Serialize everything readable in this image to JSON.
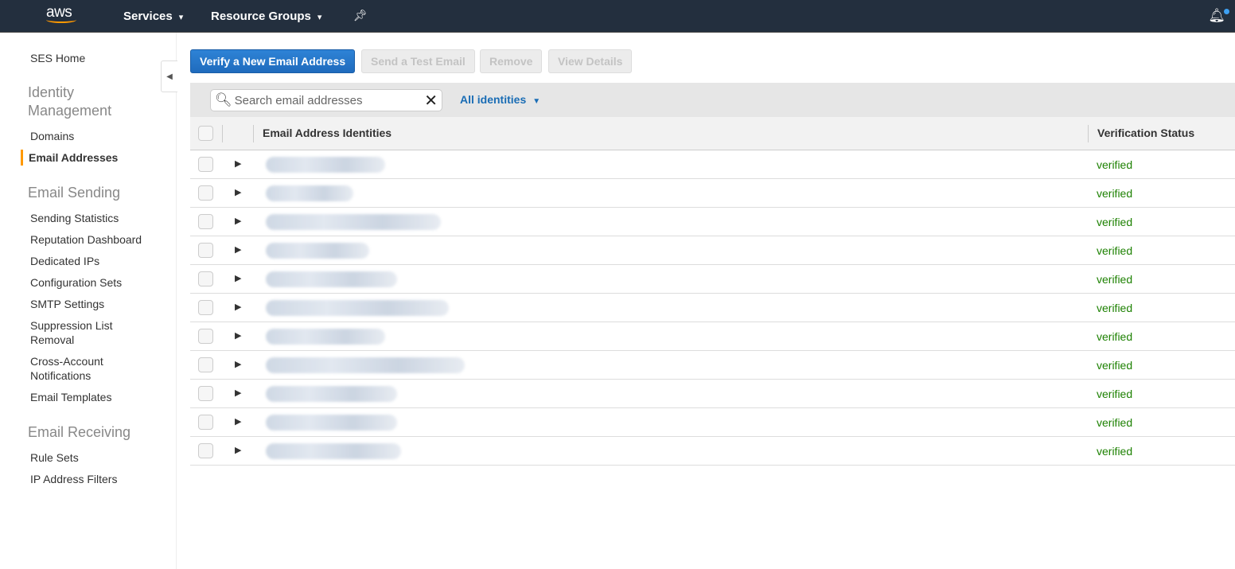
{
  "topbar": {
    "logo": "aws",
    "services": "Services",
    "resource_groups": "Resource Groups",
    "chevron": "⌄"
  },
  "sidebar": {
    "home": "SES Home",
    "sections": [
      {
        "title": "Identity Management",
        "items": [
          "Domains",
          "Email Addresses"
        ]
      },
      {
        "title": "Email Sending",
        "items": [
          "Sending Statistics",
          "Reputation Dashboard",
          "Dedicated IPs",
          "Configuration Sets",
          "SMTP Settings",
          "Suppression List Removal",
          "Cross-Account Notifications",
          "Email Templates"
        ]
      },
      {
        "title": "Email Receiving",
        "items": [
          "Rule Sets",
          "IP Address Filters"
        ]
      }
    ],
    "active": "Email Addresses"
  },
  "toolbar": {
    "verify": "Verify a New Email Address",
    "send_test": "Send a Test Email",
    "remove": "Remove",
    "view_details": "View Details"
  },
  "filter": {
    "placeholder": "Search email addresses",
    "dropdown": "All identities"
  },
  "table": {
    "columns": [
      "Email Address Identities",
      "Verification Status"
    ],
    "rows": [
      {
        "status": "verified"
      },
      {
        "status": "verified"
      },
      {
        "status": "verified"
      },
      {
        "status": "verified"
      },
      {
        "status": "verified"
      },
      {
        "status": "verified"
      },
      {
        "status": "verified"
      },
      {
        "status": "verified"
      },
      {
        "status": "verified"
      },
      {
        "status": "verified"
      },
      {
        "status": "verified"
      }
    ]
  },
  "colors": {
    "accent": "#f90",
    "primary": "#1f6bbd",
    "verified": "#1d8102",
    "topbar": "#232f3e"
  }
}
